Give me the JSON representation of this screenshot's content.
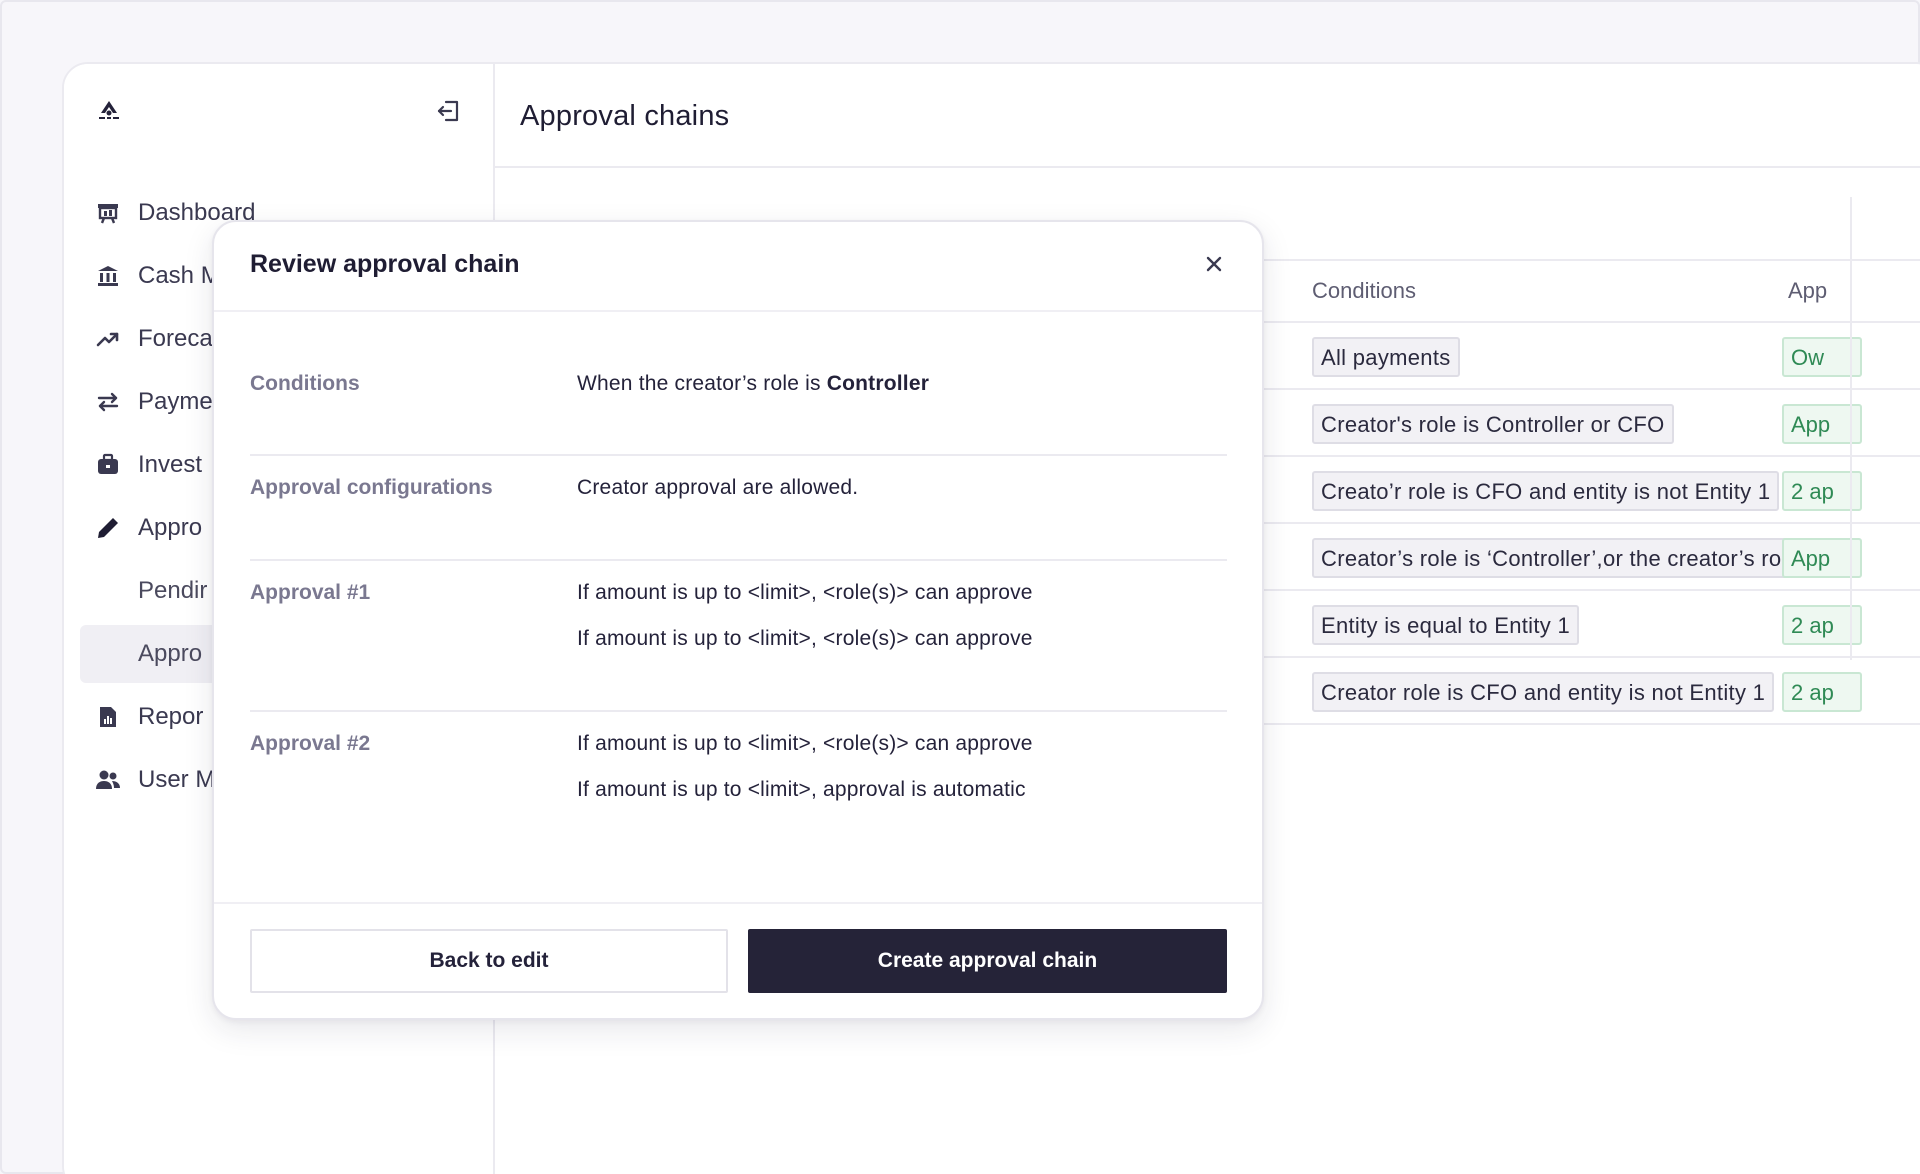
{
  "page": {
    "title": "Approval chains"
  },
  "sidebar": {
    "items": [
      {
        "label": "Dashboard",
        "icon": "dashboard-icon"
      },
      {
        "label": "Cash M",
        "icon": "bank-icon"
      },
      {
        "label": "Foreca",
        "icon": "trending-up-icon"
      },
      {
        "label": "Payme",
        "icon": "arrows-swap-icon"
      },
      {
        "label": "Invest",
        "icon": "briefcase-icon"
      },
      {
        "label": "Appro",
        "icon": "pencil-icon"
      }
    ],
    "subitems": [
      {
        "label": "Pendir"
      },
      {
        "label": "Appro"
      }
    ],
    "bottom_items": [
      {
        "label": "Repor",
        "icon": "report-icon"
      },
      {
        "label": "User M",
        "icon": "users-icon"
      }
    ]
  },
  "table": {
    "columns": [
      "Conditions",
      "App"
    ],
    "rows": [
      {
        "condition": "All payments",
        "approval": "Ow"
      },
      {
        "condition": "Creator's role is Controller or CFO",
        "approval": "App"
      },
      {
        "condition": "Creato’r role is CFO and entity is not Entity 1",
        "approval": "2 ap"
      },
      {
        "condition": "Creator’s role is ‘Controller’,or the creator’s role is",
        "approval": "App"
      },
      {
        "condition": "Entity is equal to Entity 1",
        "approval": "2 ap"
      },
      {
        "condition": "Creator role is CFO and entity is not Entity 1",
        "approval": "2 ap"
      }
    ]
  },
  "modal": {
    "title": "Review approval chain",
    "rows": {
      "conditions": {
        "label": "Conditions",
        "prefix": "When the creator’s role is ",
        "role": "Controller"
      },
      "config": {
        "label": "Approval configurations",
        "value": "Creator approval are allowed."
      },
      "approval1": {
        "label": "Approval #1",
        "lines": [
          "If amount is up to <limit>, <role(s)> can approve",
          "If amount is up to <limit>, <role(s)> can approve"
        ]
      },
      "approval2": {
        "label": "Approval #2",
        "lines": [
          "If amount is up to <limit>, <role(s)> can approve",
          "If amount is up to <limit>, approval is automatic"
        ]
      }
    },
    "back_label": "Back to edit",
    "create_label": "Create approval chain"
  },
  "colors": {
    "primary_button": "#252338",
    "approval_tag_text": "#2f8a55",
    "label_gray": "#7a7890"
  }
}
